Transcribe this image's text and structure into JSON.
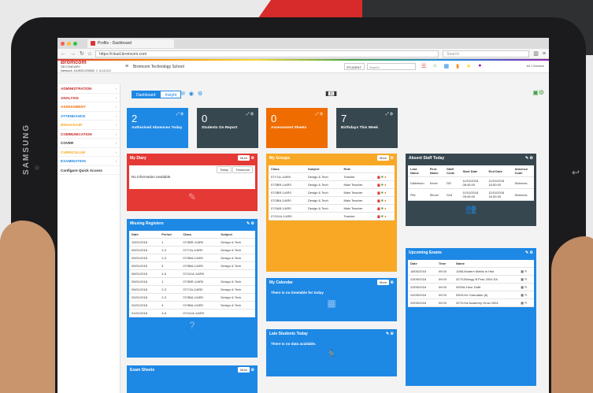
{
  "device": {
    "brand": "SAMSUNG"
  },
  "browser": {
    "tab_title": "Profile - Dashboard",
    "url": "https://cloud.bromcom.com",
    "search_placeholder": "Search"
  },
  "app": {
    "logo_main": "Bromcom",
    "logo_sub": "SECONDARY",
    "logo_detail": "Network: DUNSCO9892 ☺ 8.12.8.2",
    "school": "Bromcom Technology School",
    "student_select": "STUDENT",
    "search_placeholder": "Search",
    "user": "Mr J Morario"
  },
  "sidebar": {
    "items": [
      {
        "label": "ADMINISTRATION",
        "color": "#c62828"
      },
      {
        "label": "ANALYSIS",
        "color": "#c62828"
      },
      {
        "label": "ASSESSMENT",
        "color": "#ef6c00"
      },
      {
        "label": "ATTENDANCE",
        "color": "#1e88e5"
      },
      {
        "label": "BEHAVIOUR",
        "color": "#f9a825"
      },
      {
        "label": "COMMUNICATION",
        "color": "#c62828"
      },
      {
        "label": "COVER",
        "color": "#333333"
      },
      {
        "label": "CURRICULUM",
        "color": "#f9a825"
      },
      {
        "label": "EXAMINATION",
        "color": "#1e88e5"
      },
      {
        "label": "Configure Quick Access",
        "color": "#333333"
      }
    ]
  },
  "toggles": {
    "dashboard": "Dashboard",
    "insight": "Insight"
  },
  "tiles": [
    {
      "num": "2",
      "label": "Authorised Absences Today",
      "color": "#1e88e5"
    },
    {
      "num": "0",
      "label": "Students On Report",
      "color": "#37474f"
    },
    {
      "num": "0",
      "label": "Assessment Sheets",
      "color": "#ef6c00"
    },
    {
      "num": "7",
      "label": "Birthdays This Week",
      "color": "#37474f"
    }
  ],
  "diary": {
    "title": "My Diary",
    "more": "More",
    "today": "Today",
    "tomorrow": "Tomorrow",
    "message": "No information available"
  },
  "groups": {
    "title": "My Groups",
    "more": "More",
    "headers": [
      "Class",
      "Subject",
      "Role"
    ],
    "rows": [
      [
        "07/71A-1/AR0",
        "Design & Tech",
        "Teacher"
      ],
      [
        "07/3BR-1/AR0",
        "Design & Tech",
        "Main Teacher"
      ],
      [
        "07/3BR-1/AR0",
        "Design & Tech",
        "Main Teacher"
      ],
      [
        "07/3BA-1/AR0",
        "Design & Tech",
        "Main Teacher"
      ],
      [
        "07/3AB-1/AR0",
        "Design & Tech",
        "Main Teacher"
      ],
      [
        "07/111A-1/AR0",
        "",
        "Teacher"
      ]
    ]
  },
  "absent": {
    "title": "Absent Staff Today",
    "headers": [
      "Last Name",
      "First Name",
      "Staff Code",
      "Start Date",
      "End Date",
      "Absence Code"
    ],
    "rows": [
      [
        "Dalkinson",
        "Kevin",
        "DD",
        "11/01/2018 08:45:00",
        "11/01/2018 16:50:00",
        "Sickness"
      ],
      [
        "Pile",
        "Simon",
        "S16",
        "11/01/2018 09:45:00",
        "11/01/2018 16:50:00",
        "Sickness"
      ]
    ]
  },
  "registers": {
    "title": "Missing Registers",
    "headers": [
      "Date",
      "Period",
      "Class",
      "Subject"
    ],
    "rows": [
      [
        "10/01/2018",
        "1",
        "07/3BR-1/AR0",
        "Design & Tech"
      ],
      [
        "09/01/2018",
        "2-3",
        "07/71A-1/AR0",
        "Design & Tech"
      ],
      [
        "09/01/2018",
        "2-3",
        "07/3BA-1/AR0",
        "Design & Tech"
      ],
      [
        "09/01/2018",
        "4",
        "07/3BA-1/AR0",
        "Design & Tech"
      ],
      [
        "08/01/2018",
        "4-5",
        "07/111A-1/AR0",
        ""
      ],
      [
        "05/01/2018",
        "1",
        "07/3BR-1/AR0",
        "Design & Tech"
      ],
      [
        "05/01/2018",
        "2-3",
        "07/71A-1/AR0",
        "Design & Tech"
      ],
      [
        "02/01/2018",
        "2-3",
        "07/3BA-1/AR0",
        "Design & Tech"
      ],
      [
        "02/01/2018",
        "4",
        "07/3BA-1/AR0",
        "Design & Tech"
      ],
      [
        "01/01/2018",
        "4-5",
        "07/111A-1/AR0",
        ""
      ]
    ]
  },
  "calendar": {
    "title": "My Calendar",
    "more": "More",
    "message": "There is no timetable for today"
  },
  "late": {
    "title": "Late Students Today",
    "message": "There is no data available."
  },
  "exams": {
    "title": "Upcoming Exams",
    "headers": [
      "Date",
      "Time",
      "Name"
    ],
    "rows": [
      [
        "18/05/2018",
        "09:00",
        "1086-Modern Maths in Hist"
      ],
      [
        "23/05/2018",
        "09:00",
        "3270-Biology B Prac 2004 EA"
      ],
      [
        "23/05/2018",
        "09:00",
        "0900A-Hour Draft"
      ],
      [
        "24/05/2018",
        "09:00",
        "0500-Ho Calculator (b)"
      ],
      [
        "25/05/2018",
        "09:00",
        "3270-Ha Academy Grow 2004"
      ]
    ]
  },
  "exam_sheets": {
    "title": "Exam Sheets",
    "more": "More"
  }
}
